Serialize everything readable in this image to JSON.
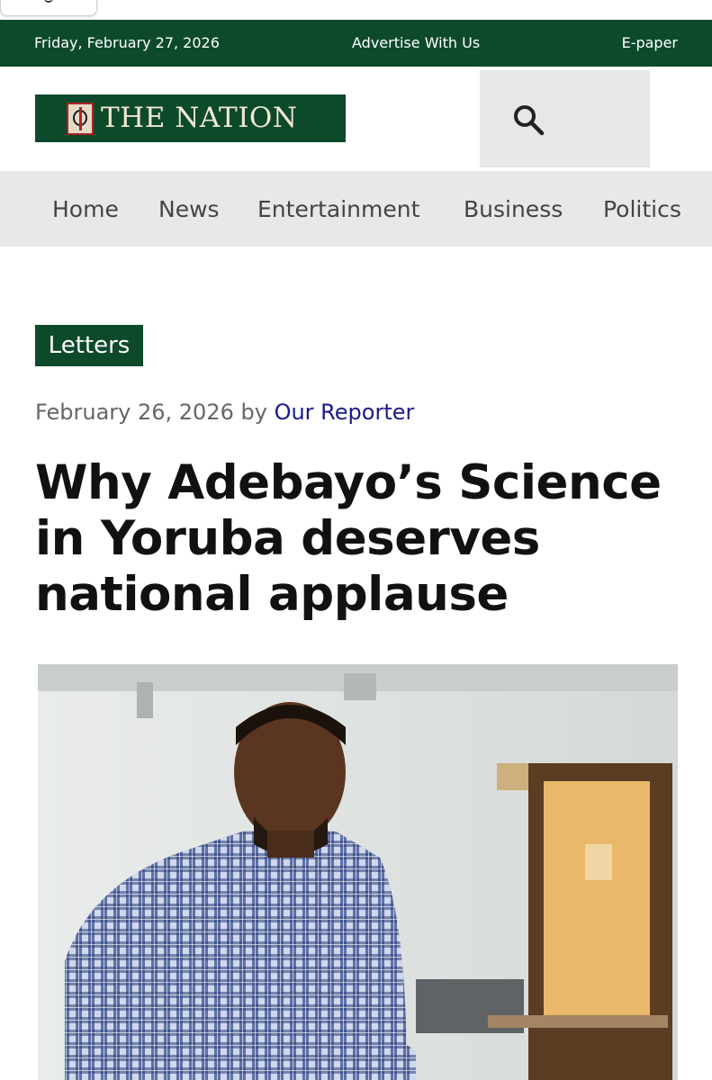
{
  "topbar": {
    "date": "Friday, February 27, 2026",
    "advertise": "Advertise With Us",
    "epaper": "E-paper"
  },
  "masthead": {
    "logo_text": "THE NATION",
    "search_icon": "search-icon"
  },
  "nav": {
    "items": [
      {
        "label": "Home"
      },
      {
        "label": "News"
      },
      {
        "label": "Entertainment"
      },
      {
        "label": "Business"
      },
      {
        "label": "Politics"
      }
    ]
  },
  "article": {
    "category": "Letters",
    "date": "February 26, 2026",
    "by": "by",
    "author": "Our Reporter",
    "title": "Why Adebayo’s Science in Yoruba deserves national applause",
    "image": {
      "icon": "article-photo"
    }
  },
  "colors": {
    "brand_green": "#0d4a2b",
    "nav_bg": "#e8e9e7",
    "author_link": "#1a1a8e"
  }
}
